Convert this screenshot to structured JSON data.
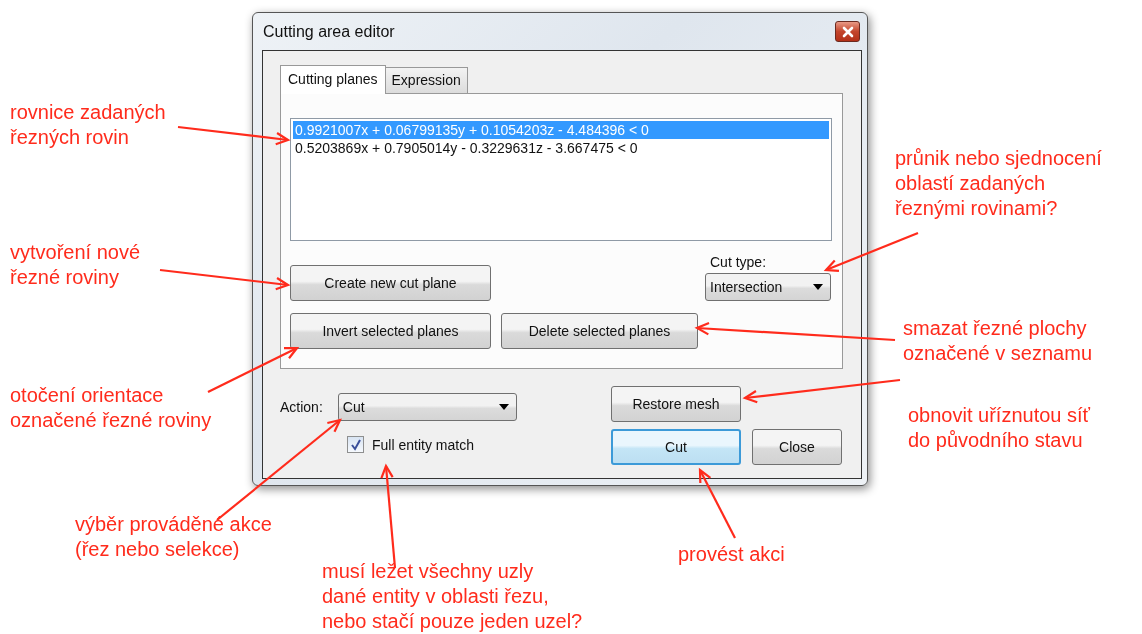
{
  "window": {
    "title": "Cutting area editor"
  },
  "tabs": [
    {
      "label": "Cutting planes",
      "selected": true
    },
    {
      "label": "Expression",
      "selected": false
    }
  ],
  "planes": [
    {
      "text": "0.9921007x + 0.06799135y + 0.1054203z - 4.484396 < 0",
      "selected": true
    },
    {
      "text": "0.5203869x + 0.7905014y - 0.3229631z - 3.667475 < 0",
      "selected": false
    }
  ],
  "plane_buttons": [
    "Create new cut plane",
    "Invert selected planes",
    "Delete selected planes"
  ],
  "cut_type": {
    "label": "Cut type:",
    "value": "Intersection"
  },
  "action": {
    "label": "Action:",
    "value": "Cut"
  },
  "full_entity_match": {
    "label": "Full entity match",
    "checked": true
  },
  "dialog_buttons": [
    {
      "label": "Restore mesh",
      "focused": false
    },
    {
      "label": "Cut",
      "focused": true
    },
    {
      "label": "Close",
      "focused": false
    }
  ],
  "annotations": [
    "rovnice zadaných\nřezných rovin",
    "vytvoření nové\nřezné roviny",
    "otočení orientace\noznačené řezné roviny",
    "výběr prováděné akce\n(řez nebo selekce)",
    "musí ležet všechny uzly\ndané entity v oblasti řezu,\nnebo stačí pouze jeden uzel?",
    "provést akci",
    "průnik nebo sjednocení\noblastí zadaných\nřeznými rovinami?",
    "smazat řezné plochy\noznačené v seznamu",
    "obnovit uříznutou síť\ndo původního stavu"
  ]
}
